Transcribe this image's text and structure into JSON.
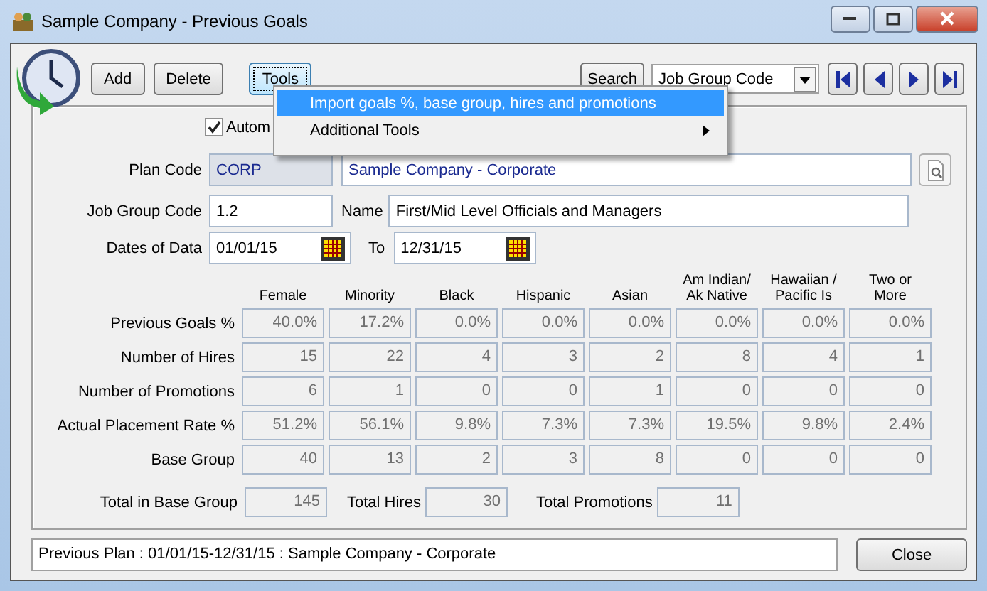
{
  "window": {
    "title": "Sample Company - Previous Goals"
  },
  "toolbar": {
    "buttons": [
      {
        "label": "Add",
        "focused": false
      },
      {
        "label": "Delete",
        "focused": false
      },
      {
        "label": "Tools",
        "focused": true
      }
    ],
    "search_button": "Search",
    "search_by": {
      "value": "Job Group Code"
    }
  },
  "menu": {
    "items": [
      {
        "label": "Import goals %, base group, hires and promotions",
        "selected": true,
        "submenu": false
      },
      {
        "label": "Additional Tools",
        "selected": false,
        "submenu": true
      }
    ]
  },
  "auto_checkbox": {
    "label": "Autom",
    "checked": true
  },
  "plan_code": {
    "label": "Plan Code",
    "value": "CORP",
    "description": "Sample Company - Corporate"
  },
  "job_group": {
    "label": "Job Group Code",
    "value": "1.2",
    "name_label": "Name",
    "name": "First/Mid Level Officials and Managers"
  },
  "dates": {
    "label": "Dates of Data",
    "from": "01/01/15",
    "to_label": "To",
    "to": "12/31/15"
  },
  "table": {
    "columns": [
      "Female",
      "Minority",
      "Black",
      "Hispanic",
      "Asian",
      "Am Indian/\nAk Native",
      "Hawaiian /\nPacific Is",
      "Two or\nMore"
    ],
    "rows": [
      {
        "label": "Previous Goals %",
        "cells": [
          "40.0%",
          "17.2%",
          "0.0%",
          "0.0%",
          "0.0%",
          "0.0%",
          "0.0%",
          "0.0%"
        ]
      },
      {
        "label": "Number of Hires",
        "cells": [
          "15",
          "22",
          "4",
          "3",
          "2",
          "8",
          "4",
          "1"
        ]
      },
      {
        "label": "Number of Promotions",
        "cells": [
          "6",
          "1",
          "0",
          "0",
          "1",
          "0",
          "0",
          "0"
        ]
      },
      {
        "label": "Actual Placement Rate %",
        "cells": [
          "51.2%",
          "56.1%",
          "9.8%",
          "7.3%",
          "7.3%",
          "19.5%",
          "9.8%",
          "2.4%"
        ]
      },
      {
        "label": "Base Group",
        "cells": [
          "40",
          "13",
          "2",
          "3",
          "8",
          "0",
          "0",
          "0"
        ]
      }
    ]
  },
  "totals": [
    {
      "label": "Total in Base Group",
      "value": "145"
    },
    {
      "label": "Total Hires",
      "value": "30"
    },
    {
      "label": "Total Promotions",
      "value": "11"
    }
  ],
  "status_bar": {
    "text": "Previous Plan : 01/01/15-12/31/15 : Sample Company - Corporate"
  },
  "close_button": "Close"
}
